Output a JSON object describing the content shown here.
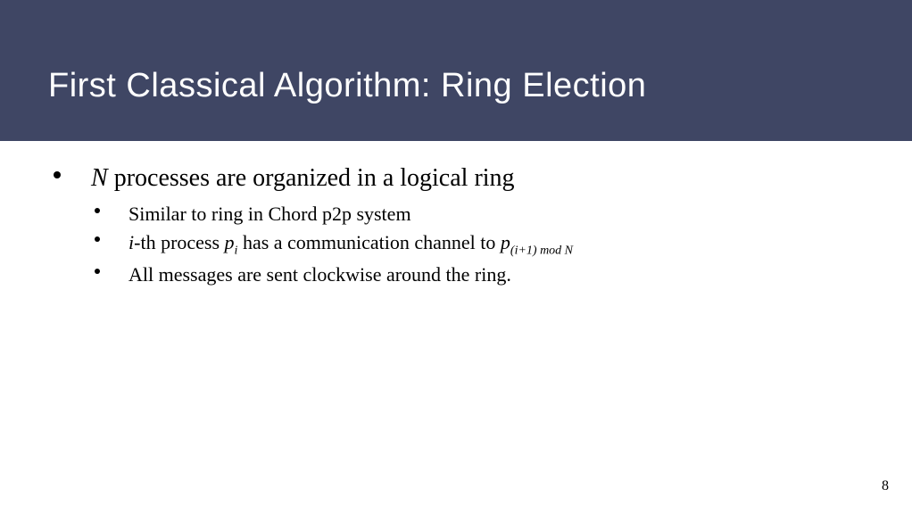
{
  "slide": {
    "title": "First Classical Algorithm: Ring Election",
    "main": {
      "text_prefix_ital": "N",
      "text_rest": " processes are organized in a logical ring",
      "sub_items": [
        {
          "parts": [
            {
              "text": "Similar to ring in Chord p2p system",
              "ital": false
            }
          ]
        },
        {
          "parts": [
            {
              "text": "i",
              "ital": true
            },
            {
              "text": "-th process ",
              "ital": false
            },
            {
              "text": "p",
              "ital": true
            },
            {
              "text": "i",
              "ital": true,
              "sub": true
            },
            {
              "text": " has a communication channel to ",
              "ital": false
            },
            {
              "text": "p",
              "ital": true
            },
            {
              "text": "(i+1) mod N",
              "ital": true,
              "sub": true
            }
          ]
        },
        {
          "parts": [
            {
              "text": " All messages are sent clockwise around the ring.",
              "ital": false
            }
          ]
        }
      ]
    },
    "page_number": "8"
  }
}
